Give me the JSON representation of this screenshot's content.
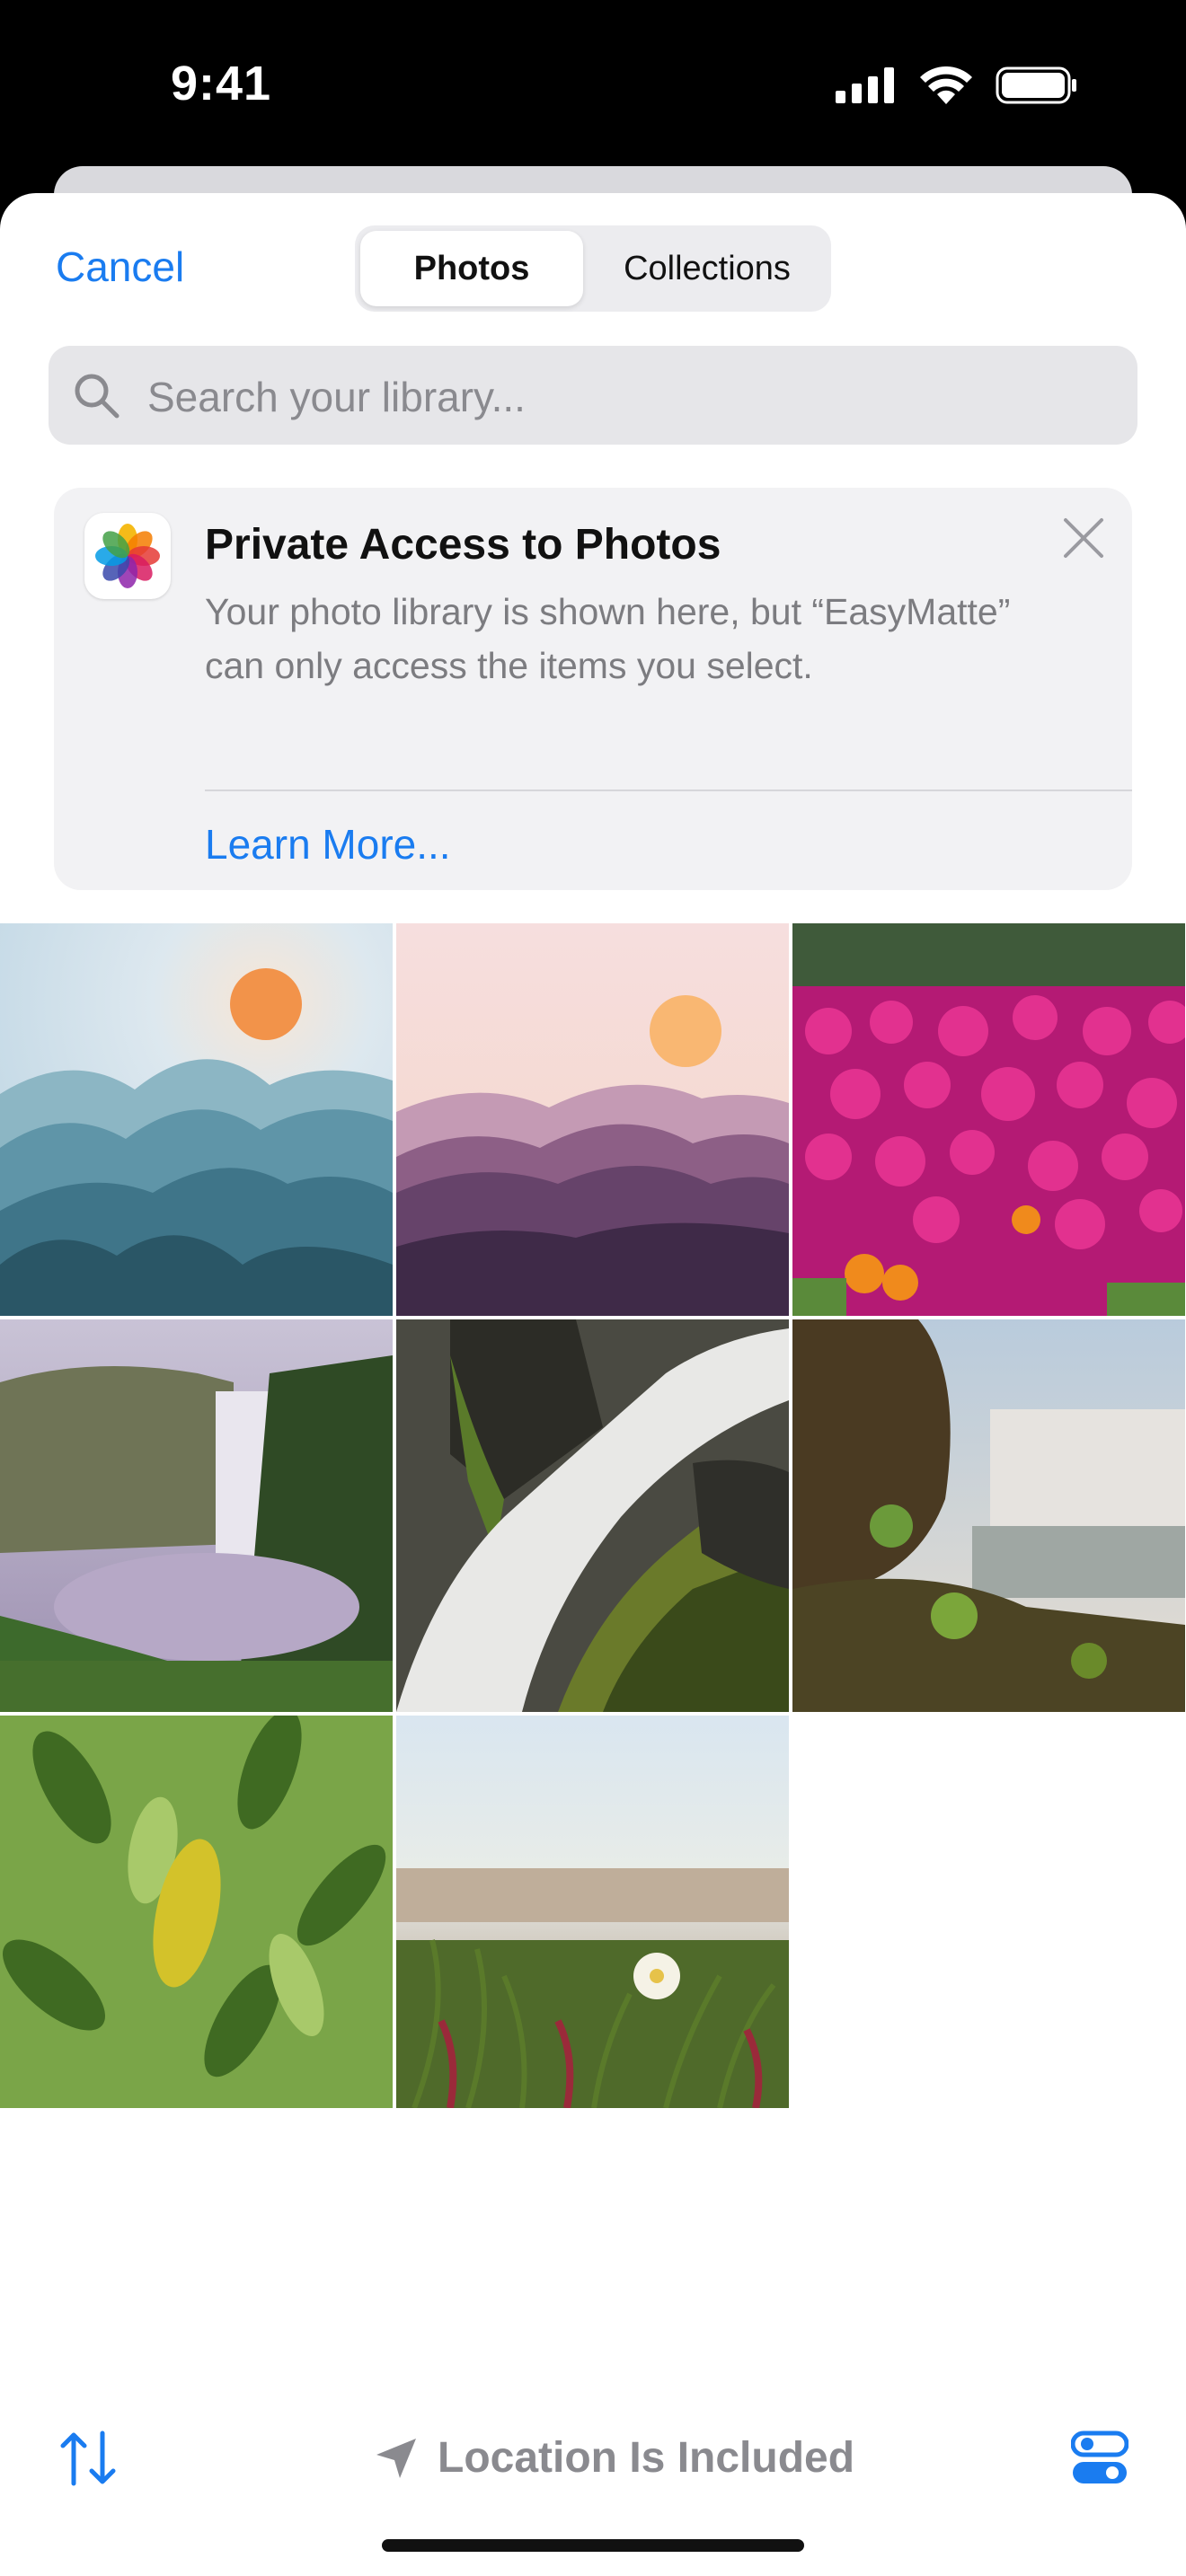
{
  "status": {
    "time": "9:41"
  },
  "header": {
    "cancel_label": "Cancel",
    "tabs": [
      {
        "label": "Photos",
        "active": true
      },
      {
        "label": "Collections",
        "active": false
      }
    ]
  },
  "search": {
    "placeholder": "Search your library..."
  },
  "banner": {
    "title": "Private Access to Photos",
    "body": "Your photo library is shown here, but “EasyMatte” can only access the items you select.",
    "link": "Learn More..."
  },
  "photos": [
    {
      "name": "blue-mountains-sun"
    },
    {
      "name": "pink-mountains-sun"
    },
    {
      "name": "magenta-flowers"
    },
    {
      "name": "waterfall-cliff"
    },
    {
      "name": "waterfall-rocks"
    },
    {
      "name": "waterfall-river"
    },
    {
      "name": "green-leaves"
    },
    {
      "name": "beach-grass-flower"
    }
  ],
  "footer": {
    "location_label": "Location Is Included"
  },
  "colors": {
    "accent": "#1a7cf0",
    "sheet": "#ffffff",
    "search_bg": "#e6e6e9",
    "banner_bg": "#f2f2f4"
  },
  "icons": [
    "search-icon",
    "close-icon",
    "photos-app-icon",
    "sort-icon",
    "location-arrow-icon",
    "options-icon",
    "signal-icon",
    "wifi-icon",
    "battery-icon"
  ]
}
